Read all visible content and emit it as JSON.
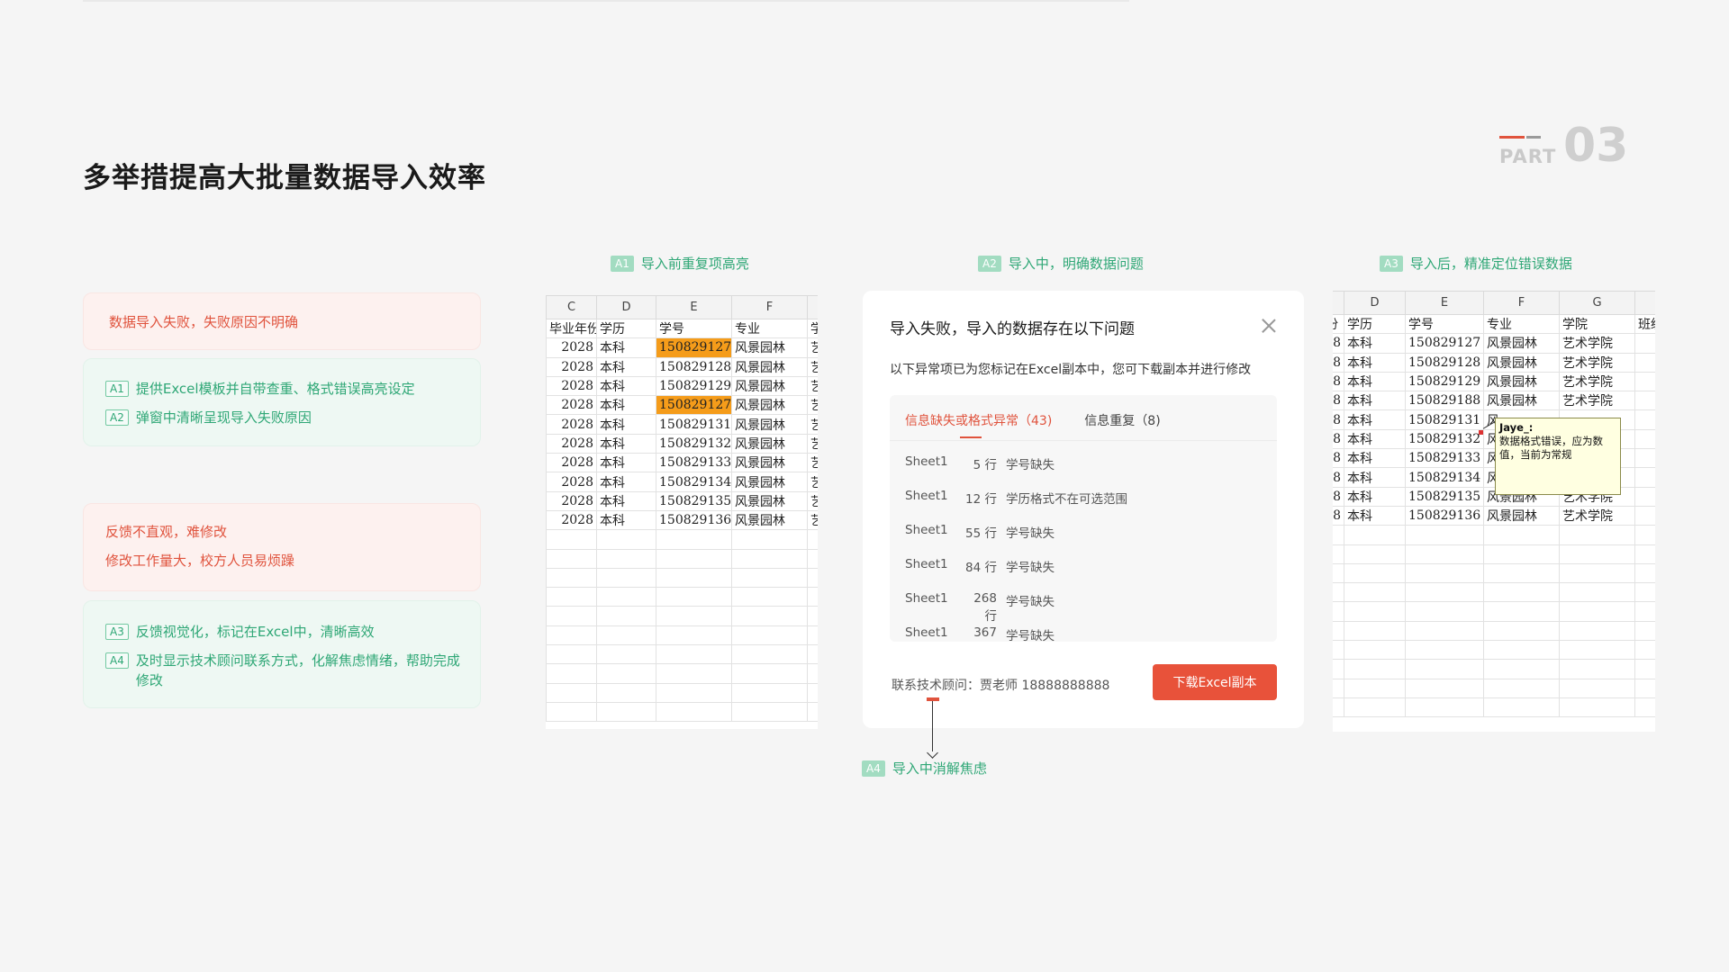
{
  "page": {
    "title": "多举措提高大批量数据导入效率",
    "part_word": "PART",
    "part_number": "03"
  },
  "left_cards": {
    "card1": {
      "text": "数据导入失败，失败原因不明确"
    },
    "card2": {
      "items": [
        {
          "tag": "A1",
          "text": "提供Excel模板并自带查重、格式错误高亮设定"
        },
        {
          "tag": "A2",
          "text": "弹窗中清晰呈现导入失败原因"
        }
      ]
    },
    "card3": {
      "lines": [
        "反馈不直观，难修改",
        "修改工作量大，校方人员易烦躁"
      ]
    },
    "card4": {
      "items": [
        {
          "tag": "A3",
          "text": "反馈视觉化，标记在Excel中，清晰高效"
        },
        {
          "tag": "A4",
          "text": "及时显示技术顾问联系方式，化解焦虑情绪，帮助完成修改"
        }
      ]
    }
  },
  "sections": {
    "a1": {
      "badge": "A1",
      "label": "导入前重复项高亮"
    },
    "a2": {
      "badge": "A2",
      "label": "导入中，明确数据问题"
    },
    "a3": {
      "badge": "A3",
      "label": "导入后，精准定位错误数据"
    },
    "a4": {
      "badge": "A4",
      "label": "导入中消解焦虑"
    }
  },
  "sheet1": {
    "columns": [
      "C",
      "D",
      "E",
      "F",
      ""
    ],
    "header_row": [
      "毕业年份",
      "学历",
      "学号",
      "专业",
      "学"
    ],
    "rows": [
      [
        "2028",
        "本科",
        "150829127",
        "风景园林",
        "艺"
      ],
      [
        "2028",
        "本科",
        "150829128",
        "风景园林",
        "艺"
      ],
      [
        "2028",
        "本科",
        "150829129",
        "风景园林",
        "艺"
      ],
      [
        "2028",
        "本科",
        "150829127",
        "风景园林",
        "艺"
      ],
      [
        "2028",
        "本科",
        "150829131",
        "风景园林",
        "艺"
      ],
      [
        "2028",
        "本科",
        "150829132",
        "风景园林",
        "艺"
      ],
      [
        "2028",
        "本科",
        "150829133",
        "风景园林",
        "艺"
      ],
      [
        "2028",
        "本科",
        "150829134",
        "风景园林",
        "艺"
      ],
      [
        "2028",
        "本科",
        "150829135",
        "风景园林",
        "艺"
      ],
      [
        "2028",
        "本科",
        "150829136",
        "风景园林",
        "艺"
      ]
    ],
    "highlight_rows": [
      0,
      3
    ],
    "highlight_color": "#f59c1a"
  },
  "dialog": {
    "title": "导入失败，导入的数据存在以下问题",
    "subtitle": "以下异常项已为您标记在Excel副本中，您可下载副本并进行修改",
    "tabs": [
      {
        "label": "信息缺失或格式异常（43)",
        "active": true
      },
      {
        "label": "信息重复（8)",
        "active": false
      }
    ],
    "issues": [
      {
        "sheet": "Sheet1",
        "row": "5 行",
        "desc": "学号缺失"
      },
      {
        "sheet": "Sheet1",
        "row": "12 行",
        "desc": "学历格式不在可选范围"
      },
      {
        "sheet": "Sheet1",
        "row": "55 行",
        "desc": "学号缺失"
      },
      {
        "sheet": "Sheet1",
        "row": "84 行",
        "desc": "学号缺失"
      },
      {
        "sheet": "Sheet1",
        "row": "268 行",
        "desc": "学号缺失"
      },
      {
        "sheet": "Sheet1",
        "row": "367 行",
        "desc": "学号缺失"
      }
    ],
    "contact": "联系技术顾问：贾老师 18888888888",
    "download_button": "下载Excel副本",
    "accent_color": "#e8523a"
  },
  "sheet3": {
    "columns": [
      "",
      "D",
      "E",
      "F",
      "G",
      ""
    ],
    "header_row": [
      "份",
      "学历",
      "学号",
      "专业",
      "学院",
      "班级"
    ],
    "rows": [
      [
        "8",
        "本科",
        "150829127",
        "风景园林",
        "艺术学院",
        ""
      ],
      [
        "8",
        "本科",
        "150829128",
        "风景园林",
        "艺术学院",
        ""
      ],
      [
        "8",
        "本科",
        "150829129",
        "风景园林",
        "艺术学院",
        ""
      ],
      [
        "8",
        "本科",
        "150829188",
        "风景园林",
        "艺术学院",
        ""
      ],
      [
        "8",
        "本科",
        "150829131",
        "风",
        "",
        ""
      ],
      [
        "8",
        "本科",
        "150829132",
        "风",
        "",
        ""
      ],
      [
        "8",
        "本科",
        "150829133",
        "风",
        "",
        ""
      ],
      [
        "8",
        "本科",
        "150829134",
        "风",
        "",
        ""
      ],
      [
        "8",
        "本科",
        "150829135",
        "风景园林",
        "艺术学院",
        ""
      ],
      [
        "8",
        "本科",
        "150829136",
        "风景园林",
        "艺术学院",
        ""
      ]
    ],
    "comment": {
      "author": "Jaye_:",
      "text": "数据格式错误，应为数值，当前为常规"
    }
  },
  "colors": {
    "green": "#2fa776",
    "red": "#e0533d",
    "background": "#f5f5f5"
  }
}
